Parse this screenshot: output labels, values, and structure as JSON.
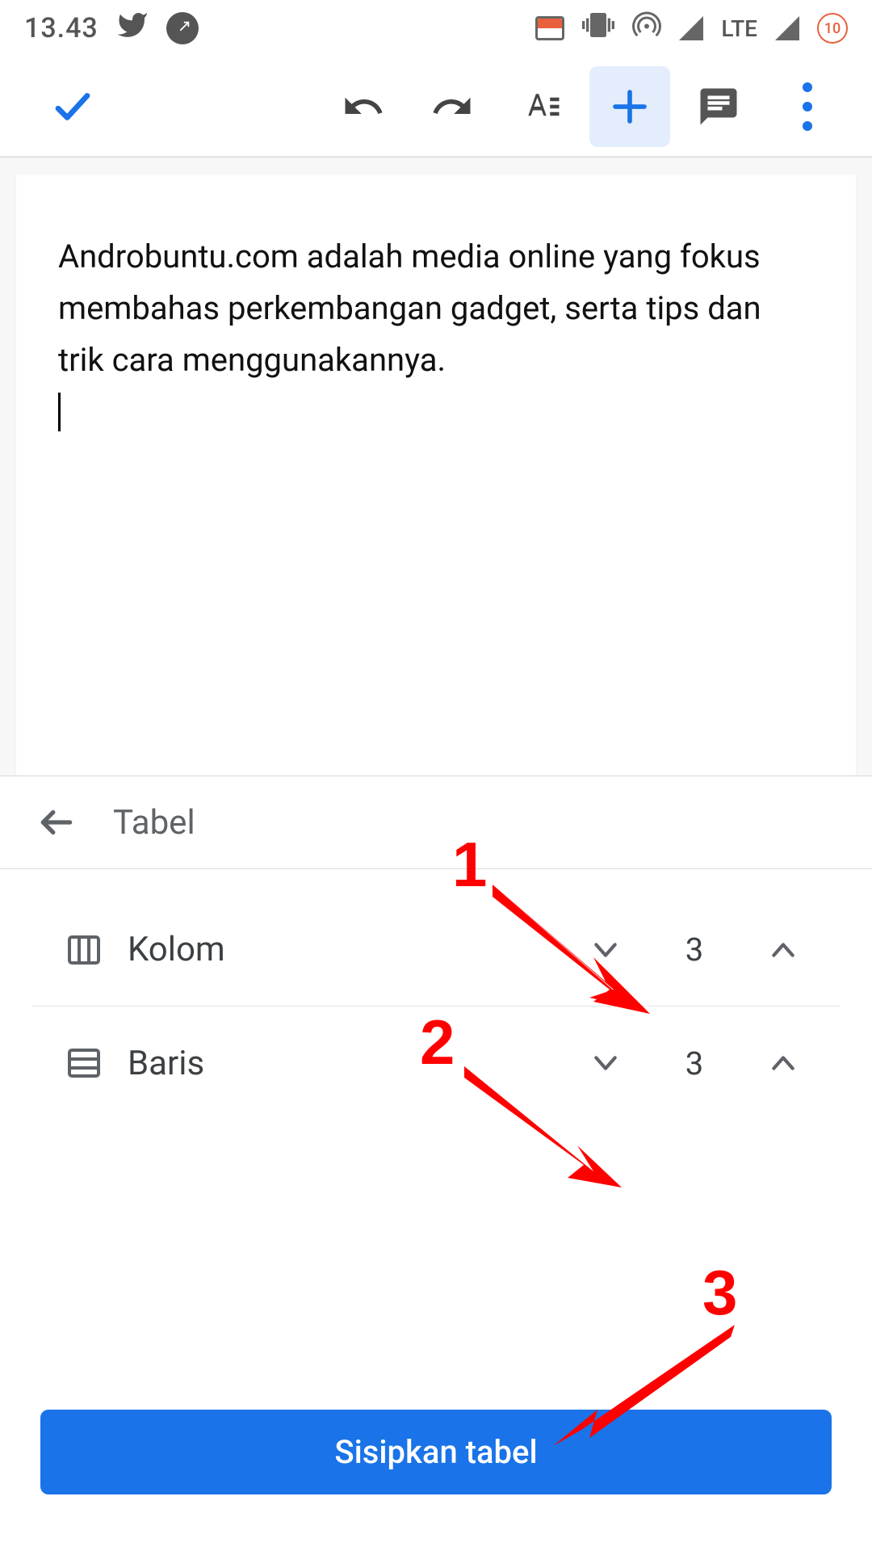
{
  "status": {
    "time": "13.43",
    "network_label": "LTE",
    "data_cap": "10"
  },
  "document": {
    "body_text": "Androbuntu.com adalah media online yang fokus membahas perkembangan gadget, serta tips dan trik cara menggunakannya."
  },
  "sheet": {
    "title": "Tabel",
    "columns": {
      "label": "Kolom",
      "value": "3"
    },
    "rows_field": {
      "label": "Baris",
      "value": "3"
    },
    "insert_label": "Sisipkan tabel"
  },
  "annotations": {
    "n1": "1",
    "n2": "2",
    "n3": "3"
  }
}
